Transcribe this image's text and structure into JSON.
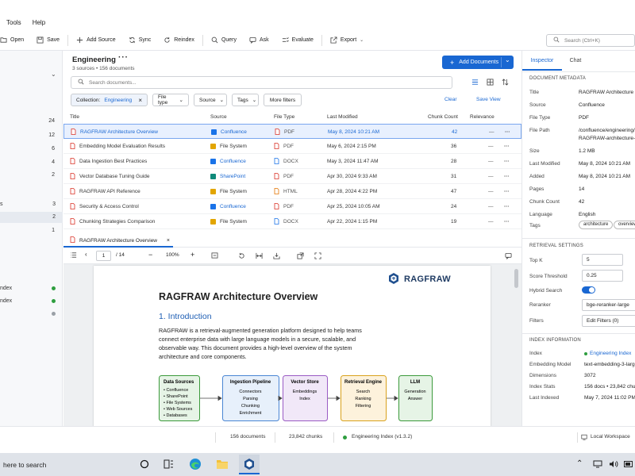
{
  "menu": {
    "tools": "Tools",
    "help": "Help"
  },
  "toolbar": {
    "open": "Open",
    "save": "Save",
    "add_source": "Add Source",
    "sync": "Sync",
    "reindex": "Reindex",
    "query": "Query",
    "ask": "Ask",
    "evaluate": "Evaluate",
    "export": "Export",
    "search_placeholder": "Search (Ctrl+K)"
  },
  "sidebar": {
    "counts": [
      "24",
      "12",
      "6",
      "4",
      "2",
      "3",
      "2",
      "1"
    ],
    "partial_labels": [
      "s",
      "ndex",
      "ndex"
    ],
    "status_colors": [
      "#2e9e3f",
      "#2e9e3f",
      "#9aa0a6"
    ]
  },
  "header": {
    "title": "Engineering",
    "subtitle": "3 sources • 156 documents",
    "add_documents": "Add Documents"
  },
  "search_docs": {
    "placeholder": "Search documents..."
  },
  "filters": {
    "collection_label": "Collection:",
    "collection_value": "Engineering",
    "file_type": "File type",
    "source": "Source",
    "tags": "Tags",
    "more_filters": "More filters",
    "clear": "Clear",
    "save_view": "Save View"
  },
  "table": {
    "headers": {
      "title": "Title",
      "source": "Source",
      "file_type": "File Type",
      "last_modified": "Last Modified",
      "chunk_count": "Chunk Count",
      "relevance": "Relevance"
    },
    "rows": [
      {
        "title": "RAGFRAW Architecture Overview",
        "source": "Confluence",
        "source_color": "#1a73e8",
        "type": "PDF",
        "modified": "May 8, 2024  10:21 AM",
        "chunks": "42",
        "relevance": "—",
        "selected": true
      },
      {
        "title": "Embedding Model Evaluation Results",
        "source": "File System",
        "source_color": "#e2a500",
        "type": "PDF",
        "modified": "May 6, 2024  2:15 PM",
        "chunks": "36",
        "relevance": "—"
      },
      {
        "title": "Data Ingestion Best Practices",
        "source": "Confluence",
        "source_color": "#1a73e8",
        "type": "DOCX",
        "modified": "May 3, 2024  11:47 AM",
        "chunks": "28",
        "relevance": "—"
      },
      {
        "title": "Vector Database Tuning Guide",
        "source": "SharePoint",
        "source_color": "#0f8a7a",
        "type": "PDF",
        "modified": "Apr 30, 2024  9:33 AM",
        "chunks": "31",
        "relevance": "—"
      },
      {
        "title": "RAGFRAW API Reference",
        "source": "File System",
        "source_color": "#e2a500",
        "type": "HTML",
        "modified": "Apr 28, 2024  4:22 PM",
        "chunks": "47",
        "relevance": "—"
      },
      {
        "title": "Security & Access Control",
        "source": "Confluence",
        "source_color": "#1a73e8",
        "type": "PDF",
        "modified": "Apr 25, 2024  10:05 AM",
        "chunks": "24",
        "relevance": "—"
      },
      {
        "title": "Chunking Strategies Comparison",
        "source": "File System",
        "source_color": "#e2a500",
        "type": "DOCX",
        "modified": "Apr 22, 2024  1:15 PM",
        "chunks": "19",
        "relevance": "—"
      }
    ]
  },
  "doc_tab": {
    "title": "RAGFRAW Architecture Overview"
  },
  "viewer": {
    "page": "1",
    "page_total": "/ 14",
    "zoom": "100%"
  },
  "document": {
    "logo": "RAGFRAW",
    "title": "RAGFRAW Architecture Overview",
    "section": "1. Introduction",
    "paragraph": "RAGFRAW is a retrieval-augmented generation platform designed to help teams connect enterprise data with large language models in a secure, scalable, and observable way. This document provides a high-level overview of the system architecture and core components.",
    "diagram": [
      {
        "title": "Data Sources",
        "items": [
          "• Confluence",
          "• SharePoint",
          "• File Systems",
          "• Web Sources",
          "• Databases"
        ],
        "fill": "#e6f4e6",
        "stroke": "#3b9a3b"
      },
      {
        "title": "Ingestion Pipeline",
        "items": [
          "Connectors",
          "Parsing",
          "Chunking",
          "Enrichment"
        ],
        "fill": "#e7f0fb",
        "stroke": "#4a86d4"
      },
      {
        "title": "Vector Store",
        "items": [
          "Embeddings",
          "Index"
        ],
        "fill": "#f1e8f8",
        "stroke": "#9a5bc4"
      },
      {
        "title": "Retrieval Engine",
        "items": [
          "Search",
          "Ranking",
          "Filtering"
        ],
        "fill": "#fdf2dc",
        "stroke": "#d9a21d"
      },
      {
        "title": "LLM",
        "items": [
          "Generation",
          "Answer"
        ],
        "fill": "#e6f4e6",
        "stroke": "#3b9a3b"
      }
    ]
  },
  "inspector": {
    "tabs": {
      "inspector": "Inspector",
      "chat": "Chat"
    },
    "metadata_title": "DOCUMENT METADATA",
    "metadata": [
      {
        "label": "Title",
        "value": "RAGFRAW Architecture Overview"
      },
      {
        "label": "Source",
        "value": "Confluence"
      },
      {
        "label": "File Type",
        "value": "PDF"
      },
      {
        "label": "File Path",
        "value": "/confluence/engineering/",
        "value2": "RAGFRAW-architecture-ov"
      },
      {
        "label": "Size",
        "value": "1.2 MB"
      },
      {
        "label": "Last Modified",
        "value": "May 8, 2024  10:21 AM"
      },
      {
        "label": "Added",
        "value": "May 8, 2024  10:21 AM"
      },
      {
        "label": "Pages",
        "value": "14"
      },
      {
        "label": "Chunk Count",
        "value": "42"
      },
      {
        "label": "Language",
        "value": "English"
      }
    ],
    "tags_label": "Tags",
    "tags": [
      "architecture",
      "overview"
    ],
    "retrieval_title": "RETRIEVAL SETTINGS",
    "top_k_label": "Top K",
    "top_k": "5",
    "threshold_label": "Score Threshold",
    "threshold": "0.25",
    "hybrid_label": "Hybrid Search",
    "hybrid_on": true,
    "reranker_label": "Reranker",
    "reranker": "bge-reranker-large",
    "filters_label": "Filters",
    "edit_filters": "Edit Filters (0)",
    "index_title": "INDEX INFORMATION",
    "index": [
      {
        "label": "Index",
        "value": "Engineering Index",
        "accent": true
      },
      {
        "label": "Embedding Model",
        "value": "text-embedding-3-large"
      },
      {
        "label": "Dimensions",
        "value": "3072"
      },
      {
        "label": "Index Stats",
        "value": "156 docs • 23,842 chunks"
      },
      {
        "label": "Last Indexed",
        "value": "May 7, 2024  11:02 PM"
      }
    ]
  },
  "status": {
    "documents": "156 documents",
    "chunks": "23,842 chunks",
    "index": "Engineering Index (v1.3.2)",
    "workspace": "Local Workspace"
  },
  "taskbar": {
    "search": "here to search"
  },
  "colors": {
    "accent": "#1967d2",
    "selected_row": "#e8f0fe",
    "status_green": "#2e9e3f"
  }
}
